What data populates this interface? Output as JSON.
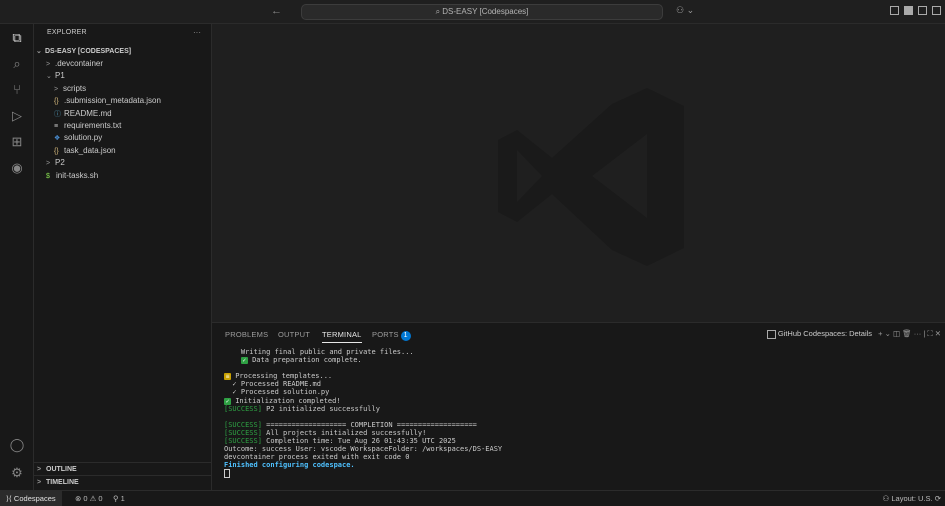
{
  "titlebar": {
    "back_forward": "← →",
    "command_center": "⌕ DS-EASY [Codespaces]",
    "copilot": "⚇ ⌄"
  },
  "activity": {
    "explorer": "⧉",
    "search": "⌕",
    "scm": "⑂",
    "run": "▷",
    "extensions": "⊞",
    "github": "◉",
    "account": "◯",
    "settings": "⚙"
  },
  "sidebar": {
    "header": "EXPLORER",
    "more": "···",
    "root": "DS-EASY [CODESPACES]",
    "items": [
      {
        "chev": ">",
        "icon": "",
        "label": ".devcontainer",
        "indent": 1
      },
      {
        "chev": "⌄",
        "icon": "",
        "label": "P1",
        "indent": 1
      },
      {
        "chev": ">",
        "icon": "",
        "label": "scripts",
        "indent": 2
      },
      {
        "chev": "",
        "icon": "{}",
        "label": ".submission_metadata.json",
        "indent": 2
      },
      {
        "chev": "",
        "icon": "ⓘ",
        "label": "README.md",
        "indent": 2
      },
      {
        "chev": "",
        "icon": "≡",
        "label": "requirements.txt",
        "indent": 2
      },
      {
        "chev": "",
        "icon": "❖",
        "label": "solution.py",
        "indent": 2
      },
      {
        "chev": "",
        "icon": "{}",
        "label": "task_data.json",
        "indent": 2
      },
      {
        "chev": ">",
        "icon": "",
        "label": "P2",
        "indent": 1
      },
      {
        "chev": "",
        "icon": "$",
        "label": "init-tasks.sh",
        "indent": 1
      }
    ],
    "outline": "OUTLINE",
    "timeline": "TIMELINE"
  },
  "panel": {
    "tabs": [
      "PROBLEMS",
      "OUTPUT",
      "TERMINAL",
      "PORTS"
    ],
    "ports_count": "1",
    "terminal_name": "GitHub Codespaces: Details",
    "actions": "+ ⌄  ◫  🗑  ···  |  ⛶  ✕"
  },
  "terminal": {
    "line1": "    Writing final public and private files...",
    "line2": "Data preparation complete.",
    "line3": "Processing templates...",
    "line4": "  ✓ Processed README.md",
    "line5": "  ✓ Processed solution.py",
    "line6": "Initialization completed!",
    "line7_tag": "[SUCCESS]",
    "line7": " P2 initialized successfully",
    "line8_tag": "[SUCCESS]",
    "line8": " =================== COMPLETION ===================",
    "line9_tag": "[SUCCESS]",
    "line9": " All projects initialized successfully!",
    "line10_tag": "[SUCCESS]",
    "line10": " Completion time: Tue Aug 26 01:43:35 UTC 2025",
    "line11": "Outcome: success User: vscode WorkspaceFolder: /workspaces/DS-EASY",
    "line12": "devcontainer process exited with exit code 0",
    "line13": "Finished configuring codespace."
  },
  "status": {
    "remote": "⟩⟨ Codespaces",
    "errors": "⊗ 0 ⚠ 0",
    "ports": "⚲ 1",
    "right": "⚇   Layout: U.S.   ⟳"
  }
}
